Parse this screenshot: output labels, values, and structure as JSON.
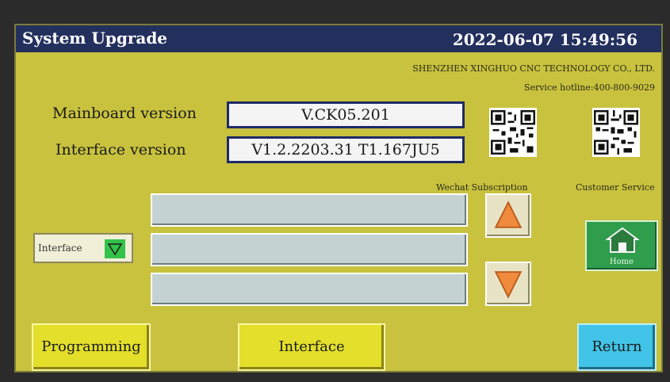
{
  "header": {
    "title": "System Upgrade",
    "datetime": "2022-06-07 15:49:56"
  },
  "info": {
    "company": "SHENZHEN XINGHUO CNC TECHNOLOGY CO., LTD.",
    "hotline": "Service hotline:400-800-9029"
  },
  "versions": {
    "mainboard_label": "Mainboard version",
    "mainboard_value": "V.CK05.201",
    "interface_label": "Interface version",
    "interface_value": "V1.2.2203.31 T1.167JU5"
  },
  "qr": {
    "wechat_label": "Wechat Subscription",
    "service_label": "Customer Service"
  },
  "file_list": {
    "rows": [
      "",
      "",
      ""
    ]
  },
  "selector": {
    "value": "Interface"
  },
  "buttons": {
    "home_label": "Home",
    "programming": "Programming",
    "interface": "Interface",
    "return": "Return"
  },
  "colors": {
    "panel": "#c9c23e",
    "titlebar": "#23305e",
    "button_yellow": "#e3df2a",
    "button_cyan": "#41c4e8",
    "home_green": "#2f9d4c",
    "arrow_orange": "#f08a3c"
  },
  "icons": {
    "up": "up-triangle-icon",
    "down": "down-triangle-icon",
    "home": "house-icon",
    "dropdown": "dropdown-triangle-icon"
  }
}
